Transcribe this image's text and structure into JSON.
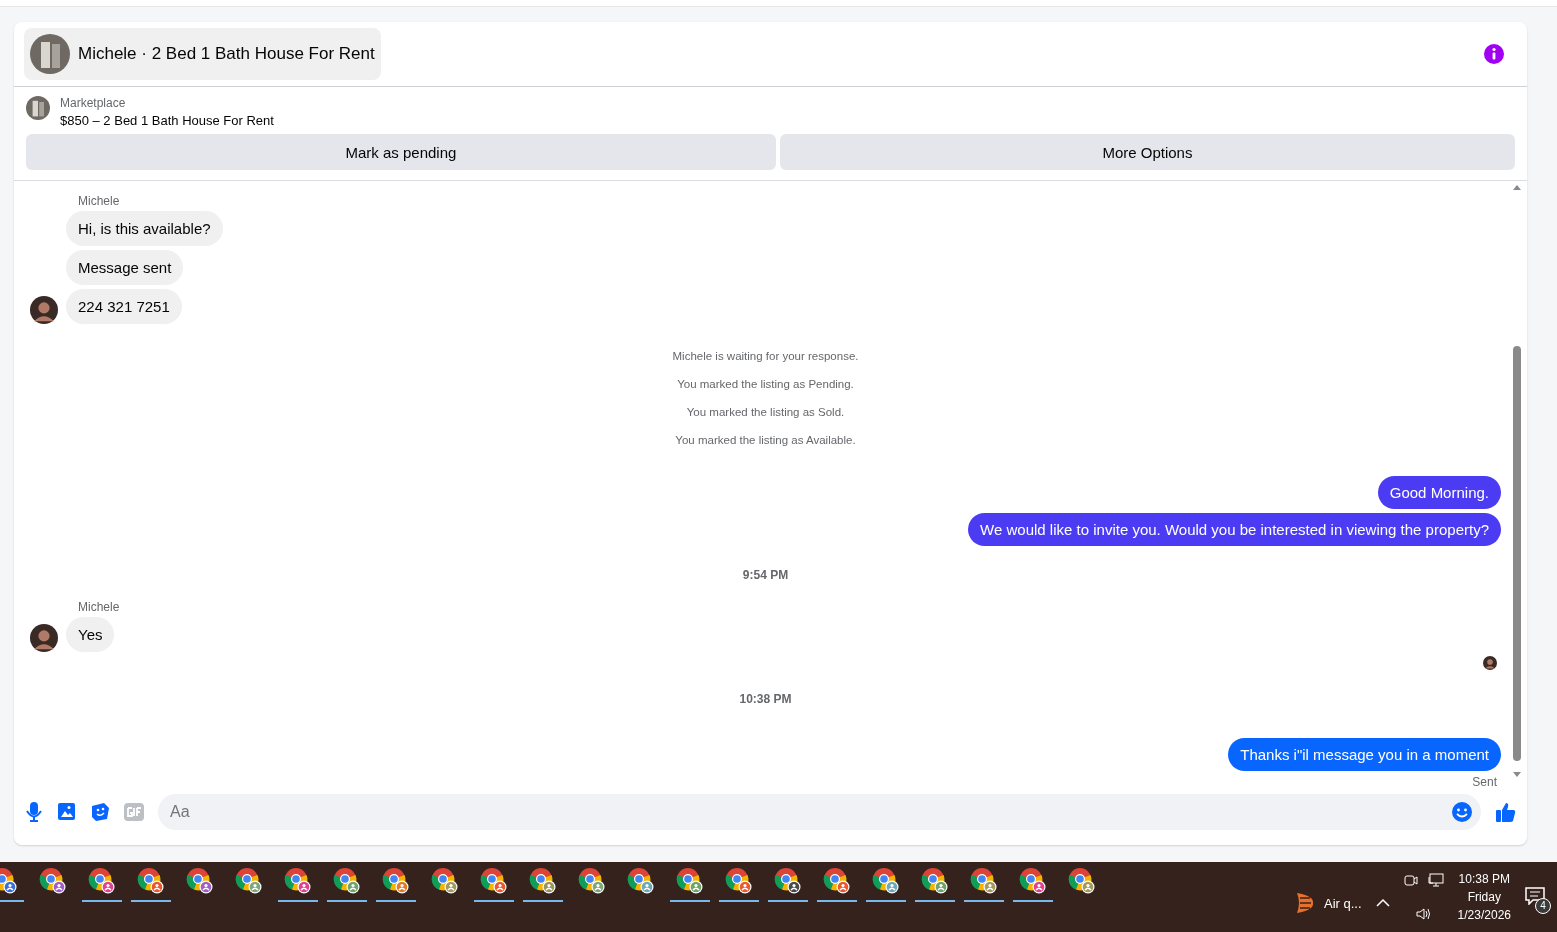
{
  "header": {
    "title": "Michele · 2 Bed 1 Bath House For Rent"
  },
  "listing": {
    "source": "Marketplace",
    "summary": "$850 – 2 Bed 1 Bath House For Rent"
  },
  "actions": [
    "Mark as pending",
    "More Options"
  ],
  "messages": [
    {
      "kind": "sender",
      "text": "Michele"
    },
    {
      "kind": "incoming",
      "text": "Hi, is this available?",
      "avatar": false
    },
    {
      "kind": "incoming",
      "text": "Message sent",
      "avatar": false
    },
    {
      "kind": "incoming",
      "text": "224 321 7251",
      "avatar": true
    },
    {
      "kind": "notice",
      "text": "Michele is waiting for your response."
    },
    {
      "kind": "notice",
      "text": "You marked the listing as Pending."
    },
    {
      "kind": "notice",
      "text": "You marked the listing as Sold."
    },
    {
      "kind": "notice",
      "text": "You marked the listing as Available."
    },
    {
      "kind": "outgoing",
      "text": "Good Morning.",
      "color": "#4b3cf4"
    },
    {
      "kind": "outgoing",
      "text": "We would like to invite you. Would you be interested in viewing the property?",
      "color": "#4b3cf4"
    },
    {
      "kind": "time",
      "text": "9:54 PM"
    },
    {
      "kind": "sender",
      "text": "Michele"
    },
    {
      "kind": "incoming",
      "text": "Yes",
      "avatar": true
    },
    {
      "kind": "seen"
    },
    {
      "kind": "time",
      "text": "10:38 PM"
    },
    {
      "kind": "outgoing",
      "text": "Thanks i\"il message you in a moment",
      "color": "#0866ff"
    },
    {
      "kind": "status",
      "text": "Sent"
    }
  ],
  "composer": {
    "placeholder": "Aa"
  },
  "taskbar": {
    "apps": [
      {
        "color": "#3b6fd6",
        "active": true
      },
      {
        "color": "#a15ec9",
        "active": false
      },
      {
        "color": "#e0428f",
        "active": true
      },
      {
        "color": "#e9582f",
        "active": true
      },
      {
        "color": "#a15ec9",
        "active": false
      },
      {
        "color": "#7fa57a",
        "active": false
      },
      {
        "color": "#e0428f",
        "active": true
      },
      {
        "color": "#6fa36a",
        "active": true
      },
      {
        "color": "#e07b2a",
        "active": true
      },
      {
        "color": "#a59a5e",
        "active": false
      },
      {
        "color": "#e9582f",
        "active": true
      },
      {
        "color": "#9a9560",
        "active": true
      },
      {
        "color": "#7fa57a",
        "active": false
      },
      {
        "color": "#6ea8b8",
        "active": false
      },
      {
        "color": "#6fa36a",
        "active": true
      },
      {
        "color": "#e9582f",
        "active": true
      },
      {
        "color": "#4a4a4a",
        "active": true
      },
      {
        "color": "#e9582f",
        "active": true
      },
      {
        "color": "#6ea8b8",
        "active": true
      },
      {
        "color": "#6fa36a",
        "active": true
      },
      {
        "color": "#a59a5e",
        "active": true
      },
      {
        "color": "#e0428f",
        "active": true
      },
      {
        "color": "#a59a5e",
        "active": false
      }
    ],
    "weather": "Air q...",
    "time": "10:38 PM",
    "day": "Friday",
    "date": "1/23/2026",
    "notifications": "4"
  }
}
